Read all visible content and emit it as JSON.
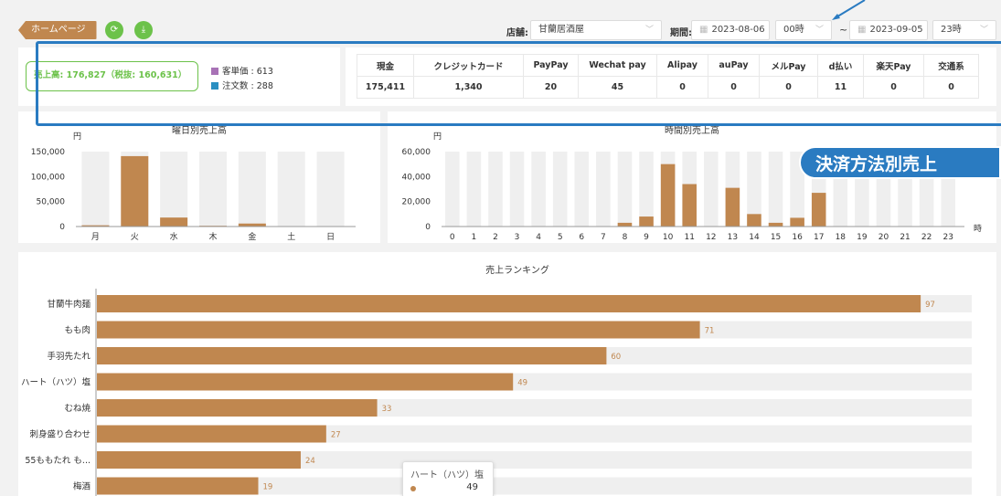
{
  "header": {
    "home_label": "ホームページ",
    "refresh_icon": "refresh-icon",
    "download_icon": "download-icon",
    "store_label": "店舗:",
    "store_value": "甘蘭居酒屋",
    "period_label": "期間:",
    "start_date": "2023-08-06",
    "start_hour": "00時",
    "separator": "~",
    "end_date": "2023-09-05",
    "end_hour": "23時"
  },
  "summary": {
    "sales_text": "売上高: 176,827（税抜: 160,631）",
    "unit_price": "客単価 : 613",
    "order_count": "注文数 : 288",
    "unit_price_color": "#a872b6",
    "order_count_color": "#2a8fc1"
  },
  "payments": {
    "headers": [
      "現金",
      "クレジットカード",
      "PayPay",
      "Wechat pay",
      "Alipay",
      "auPay",
      "メルPay",
      "d払い",
      "楽天Pay",
      "交通系"
    ],
    "values": [
      "175,411",
      "1,340",
      "20",
      "45",
      "0",
      "0",
      "0",
      "11",
      "0",
      "0"
    ]
  },
  "annotation": {
    "callout_text": "決済方法別売上",
    "color": "#2a7bc1"
  },
  "colors": {
    "bar": "#c0874f",
    "bar_bg": "#efefef",
    "green": "#6cc24a"
  },
  "chart_data": [
    {
      "type": "bar",
      "title": "曜日別売上高",
      "ylabel": "円",
      "categories": [
        "月",
        "火",
        "水",
        "木",
        "金",
        "土",
        "日"
      ],
      "values": [
        2500,
        141000,
        18000,
        1500,
        6000,
        0,
        0
      ],
      "ylim": [
        0,
        150000
      ],
      "yticks": [
        "150,000",
        "100,000",
        "50,000",
        "0"
      ]
    },
    {
      "type": "bar",
      "title": "時間別売上高",
      "ylabel": "円",
      "xlabel": "時",
      "categories": [
        "0",
        "1",
        "2",
        "3",
        "4",
        "5",
        "6",
        "7",
        "8",
        "9",
        "10",
        "11",
        "12",
        "13",
        "14",
        "15",
        "16",
        "17",
        "18",
        "19",
        "20",
        "21",
        "22",
        "23"
      ],
      "values": [
        0,
        0,
        0,
        0,
        0,
        0,
        0,
        0,
        3000,
        8000,
        50000,
        34000,
        300,
        31000,
        10000,
        3000,
        7000,
        27000,
        0,
        0,
        0,
        0,
        0,
        0
      ],
      "ylim": [
        0,
        60000
      ],
      "yticks": [
        "60,000",
        "40,000",
        "20,000",
        "0"
      ]
    },
    {
      "type": "bar",
      "orientation": "horizontal",
      "title": "売上ランキング",
      "categories": [
        "甘蘭牛肉麺",
        "もも肉",
        "手羽先たれ",
        "ハート（ハツ）塩",
        "むね焼",
        "刺身盛り合わせ",
        "55ももたれ も...",
        "梅酒"
      ],
      "values": [
        97,
        71,
        60,
        49,
        33,
        27,
        24,
        19
      ],
      "xlim": [
        0,
        100
      ]
    }
  ],
  "tooltip": {
    "name": "ハート（ハツ）塩",
    "value": "49"
  }
}
